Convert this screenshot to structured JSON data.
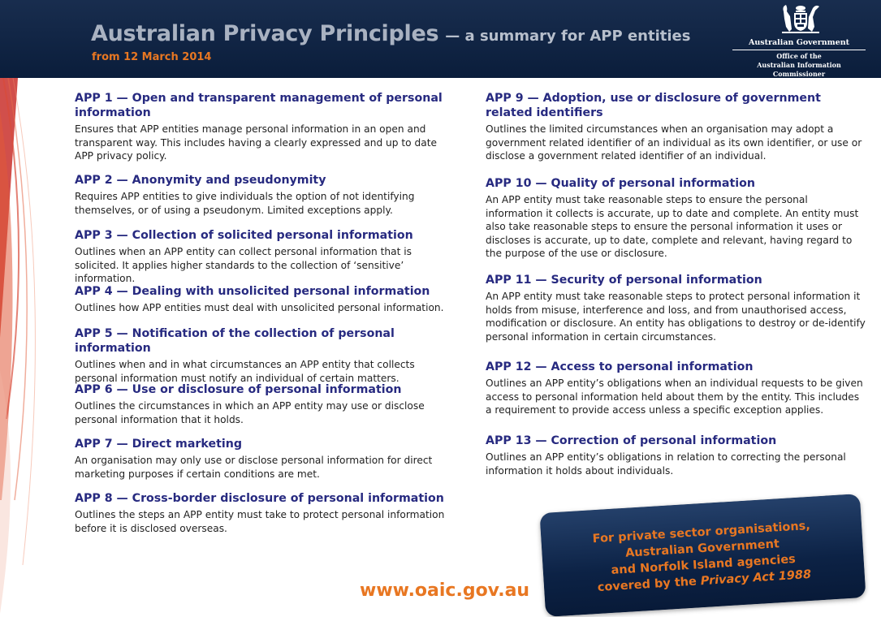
{
  "header": {
    "title": "Australian Privacy Principles",
    "title_suffix": "— a summary for APP entities",
    "subtitle": "from 12 March 2014",
    "gov_name": "Australian Government",
    "office_line1": "Office of the",
    "office_line2": "Australian Information Commissioner"
  },
  "left_column": [
    {
      "heading": "APP 1 — Open and transparent management of personal information",
      "text": "Ensures that APP entities manage personal information in an open and transparent way. This includes having a clearly expressed and up to date APP privacy policy."
    },
    {
      "heading": "APP 2 — Anonymity and pseudonymity",
      "text": "Requires APP entities to give individuals the option of not identifying themselves, or of using a pseudonym. Limited exceptions apply."
    },
    {
      "heading": "APP 3 — Collection of solicited personal information",
      "text": "Outlines when an APP entity can collect personal information that is solicited. It applies higher standards to the collection of ‘sensitive’ information."
    },
    {
      "heading": "APP 4 — Dealing with unsolicited personal information",
      "text": "Outlines how APP entities must deal with unsolicited personal information."
    },
    {
      "heading": "APP 5 — Notification of the collection of personal information",
      "text": "Outlines when and in what circumstances an APP entity that collects personal information must notify an individual of certain matters."
    },
    {
      "heading": "APP 6 — Use or disclosure of personal information",
      "text": "Outlines the circumstances in which an APP entity may use or disclose personal information that it holds."
    },
    {
      "heading": "APP 7 — Direct marketing",
      "text": "An organisation may only use or disclose personal information for direct marketing purposes if certain conditions are met."
    },
    {
      "heading": "APP 8 — Cross-border disclosure of personal information",
      "text": "Outlines the steps an APP entity must take to protect personal information before it is disclosed overseas."
    }
  ],
  "right_column": [
    {
      "heading": "APP 9 — Adoption, use or disclosure of government related identifiers",
      "text": "Outlines the limited circumstances when an organisation may adopt a government related identifier of an individual as its own identifier, or use or disclose a government related identifier of an individual."
    },
    {
      "heading": "APP 10 — Quality of personal information",
      "text": "An APP entity must take reasonable steps to ensure the personal information it collects is accurate, up to date and complete. An entity must also take reasonable steps to ensure the personal information it uses or discloses is accurate, up to date, complete and relevant, having regard to the purpose of the use or disclosure."
    },
    {
      "heading": "APP 11 — Security of personal information",
      "text": "An APP entity must take reasonable steps to protect personal information it holds from misuse, interference and loss, and from unauthorised access, modification or disclosure. An entity has obligations to destroy or de-identify personal information in certain circumstances."
    },
    {
      "heading": "APP 12 — Access to personal information",
      "text": "Outlines an APP entity’s obligations when an individual requests to be given access to personal information held about them by the entity. This includes a requirement to provide access unless a specific exception applies."
    },
    {
      "heading": "APP 13 — Correction of personal information",
      "text": "Outlines an APP entity’s obligations in relation to correcting the personal information it holds about individuals."
    }
  ],
  "footer": {
    "url": "www.oaic.gov.au",
    "callout_line1": "For private sector organisations,",
    "callout_line2": "Australian Government",
    "callout_line3": "and Norfolk Island agencies",
    "callout_line4_prefix": "covered by the ",
    "callout_line4_italic": "Privacy Act 1988"
  }
}
